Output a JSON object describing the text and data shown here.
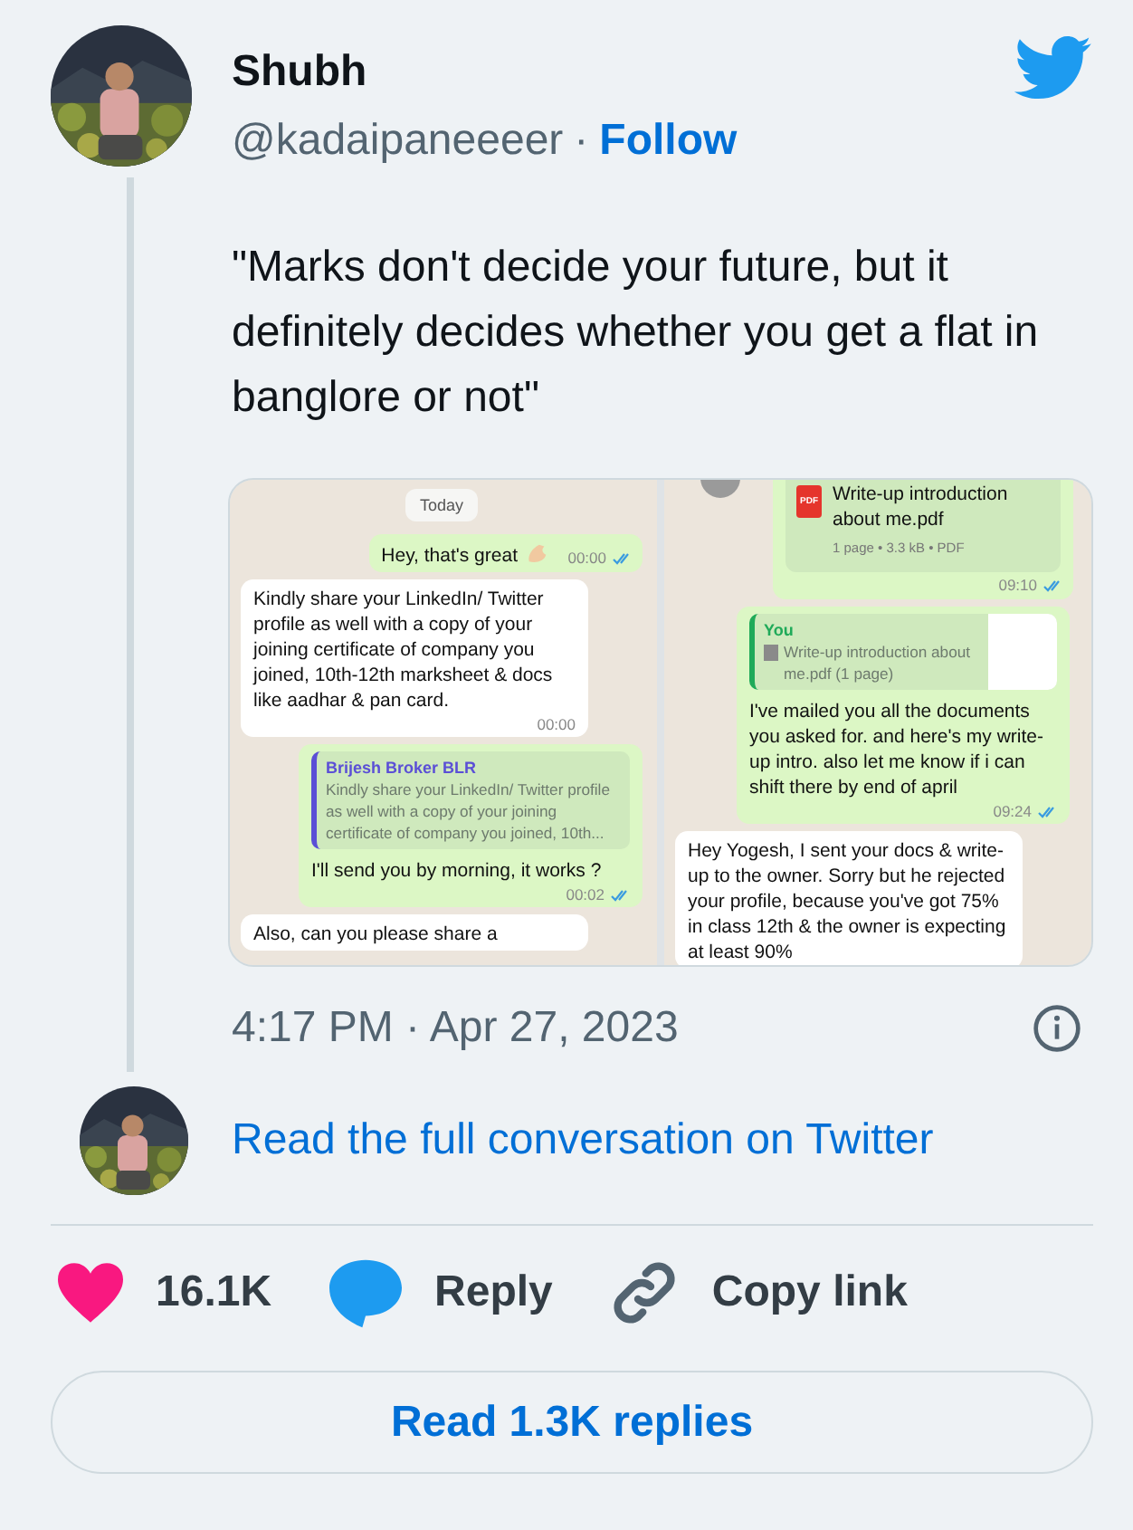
{
  "tweet": {
    "author": {
      "name": "Shubh",
      "handle": "@kadaipaneeeer",
      "separator": "·",
      "follow": "Follow"
    },
    "text": "\"Marks don't decide your future, but it definitely decides whether you get a flat in banglore or not\"",
    "media": {
      "panels": [
        {
          "top_button": false,
          "messages": [
            {
              "kind": "date",
              "text": "Today"
            },
            {
              "kind": "text",
              "outgoing": true,
              "text": "Hey, that's great",
              "emoji": true,
              "time": "00:00",
              "read": true
            },
            {
              "kind": "text",
              "outgoing": false,
              "text": "Kindly share your LinkedIn/ Twitter profile as well with a copy of your joining certificate of company you joined, 10th-12th marksheet & docs like aadhar & pan card.",
              "time": "00:00"
            },
            {
              "kind": "reply",
              "outgoing": true,
              "quote": {
                "author": "Brijesh Broker BLR",
                "color": "#5b4fd6",
                "text": "Kindly share your LinkedIn/ Twitter profile as well with a copy of your joining certificate of company you joined, 10th..."
              },
              "text": "I'll send you by morning, it works ?",
              "time": "00:02",
              "read": true
            },
            {
              "kind": "text",
              "outgoing": false,
              "text": "Also, can you please share a"
            }
          ]
        },
        {
          "top_button": true,
          "messages": [
            {
              "kind": "document",
              "outgoing": true,
              "document": {
                "badge": "PDF",
                "name": "Write-up introduction about me.pdf",
                "meta": "1 page • 3.3 kB • PDF"
              },
              "time": "09:10",
              "read": true
            },
            {
              "kind": "reply",
              "outgoing": true,
              "quote": {
                "author": "You",
                "color": "#1faa59",
                "text": "Write-up introduction about me.pdf (1 page)",
                "doc": true,
                "thumbnail": true
              },
              "text": "I've mailed you all the documents you asked for. and here's my write-up intro. also let me know if i can shift there by end of april",
              "time": "09:24",
              "read": true
            },
            {
              "kind": "text",
              "outgoing": false,
              "text": "Hey Yogesh, I sent your docs & write-up to the owner. Sorry but he rejected your profile, because you've got 75% in class 12th & the owner is expecting at least 90%"
            }
          ]
        }
      ]
    },
    "timestamp": "4:17 PM · Apr 27, 2023",
    "read_conversation": "Read the full conversation on Twitter",
    "actions": [
      {
        "kind": "like",
        "label": "16.1K"
      },
      {
        "kind": "reply",
        "label": "Reply"
      },
      {
        "kind": "copy",
        "label": "Copy link"
      }
    ],
    "read_replies": "Read 1.3K replies"
  }
}
